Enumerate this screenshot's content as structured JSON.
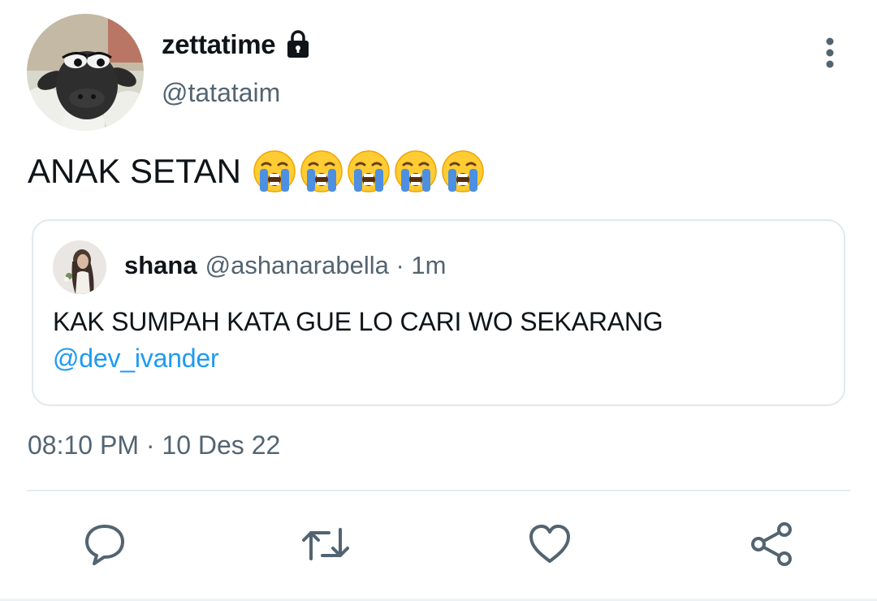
{
  "tweet": {
    "display_name": "zettatime",
    "handle": "@tatataim",
    "text": "ANAK SETAN",
    "emojis": [
      "loudly-crying-face",
      "loudly-crying-face",
      "loudly-crying-face",
      "loudly-crying-face",
      "loudly-crying-face"
    ],
    "timestamp": "08:10 PM · 10 Des 22"
  },
  "quote": {
    "name": "shana",
    "meta": "@ashanarabella · 1m",
    "text": "KAK SUMPAH KATA GUE LO CARI WO SEKARANG",
    "mention": "@dev_ivander"
  },
  "actions": [
    "reply-icon",
    "retweet-icon",
    "like-icon",
    "share-icon"
  ],
  "colors": {
    "text": "#0f1419",
    "secondary": "#536471",
    "link": "#1d9bf0",
    "border": "#e1e8ed"
  }
}
